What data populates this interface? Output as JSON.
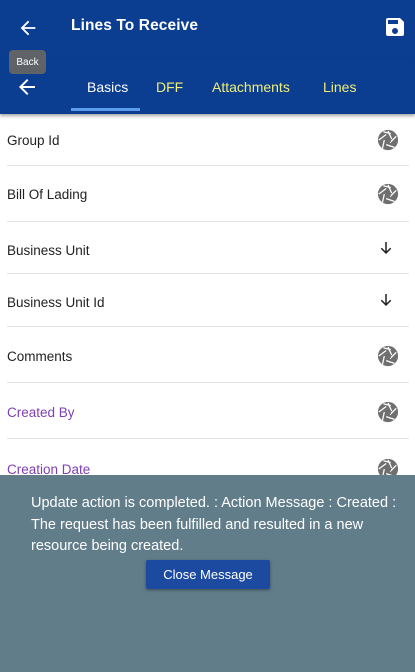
{
  "header": {
    "title": "Lines To Receive",
    "back_tooltip": "Back",
    "back_icon": "arrow-left-icon",
    "save_icon": "floppy-disk-icon"
  },
  "tabs": [
    {
      "label": "Basics",
      "active": true
    },
    {
      "label": "DFF",
      "active": false
    },
    {
      "label": "Attachments",
      "active": false
    },
    {
      "label": "Lines",
      "active": false
    }
  ],
  "fields": [
    {
      "label": "Group Id",
      "icon": "camera-shutter-icon"
    },
    {
      "label": "Bill Of Lading",
      "icon": "camera-shutter-icon"
    },
    {
      "label": "Business Unit",
      "icon": "arrow-down-icon"
    },
    {
      "label": "Business Unit Id",
      "icon": "arrow-down-icon"
    },
    {
      "label": "Comments",
      "icon": "camera-shutter-icon"
    },
    {
      "label": "Created By",
      "icon": "camera-shutter-icon"
    },
    {
      "label": "Creation Date",
      "icon": "camera-shutter-icon"
    }
  ],
  "message": {
    "text": "Update action is completed.  : Action Message : Created : The request has been fulfilled and resulted in a new resource being created.",
    "close_label": "Close Message"
  },
  "colors": {
    "header_bg": "#0b3d91",
    "tab_inactive": "#f0ee78",
    "overlay_bg": "#627d8a",
    "label_readonly": "#7d3fb6"
  }
}
